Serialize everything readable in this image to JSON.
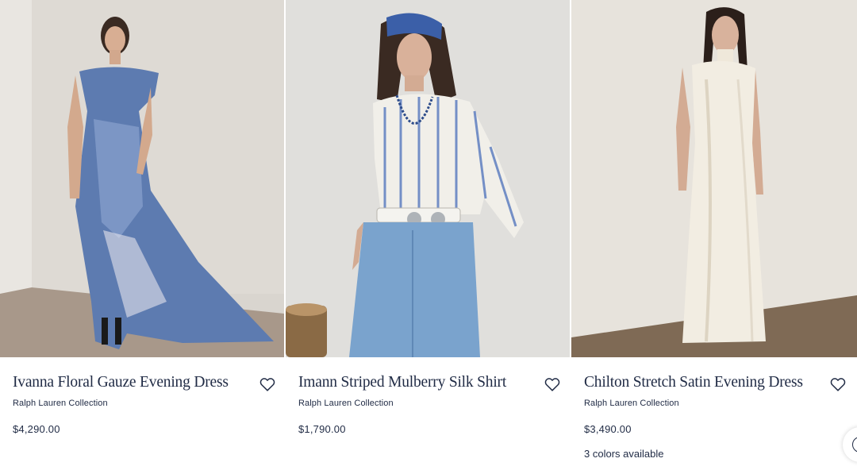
{
  "products": [
    {
      "title": "Ivanna Floral Gauze Evening Dress",
      "brand": "Ralph Lauren Collection",
      "price": "$4,290.00",
      "colors_note": "",
      "image_icon": "photo-blue-floral-gown"
    },
    {
      "title": "Imann Striped Mulberry Silk Shirt",
      "brand": "Ralph Lauren Collection",
      "price": "$1,790.00",
      "colors_note": "",
      "image_icon": "photo-striped-shirt-denim"
    },
    {
      "title": "Chilton Stretch Satin Evening Dress",
      "brand": "Ralph Lauren Collection",
      "price": "$3,490.00",
      "colors_note": "3 colors available",
      "image_icon": "photo-ivory-satin-gown"
    }
  ],
  "icons": {
    "wishlist": "heart-icon",
    "chat": "chat-icon"
  },
  "colors": {
    "text": "#1f2a44",
    "background": "#ffffff"
  }
}
